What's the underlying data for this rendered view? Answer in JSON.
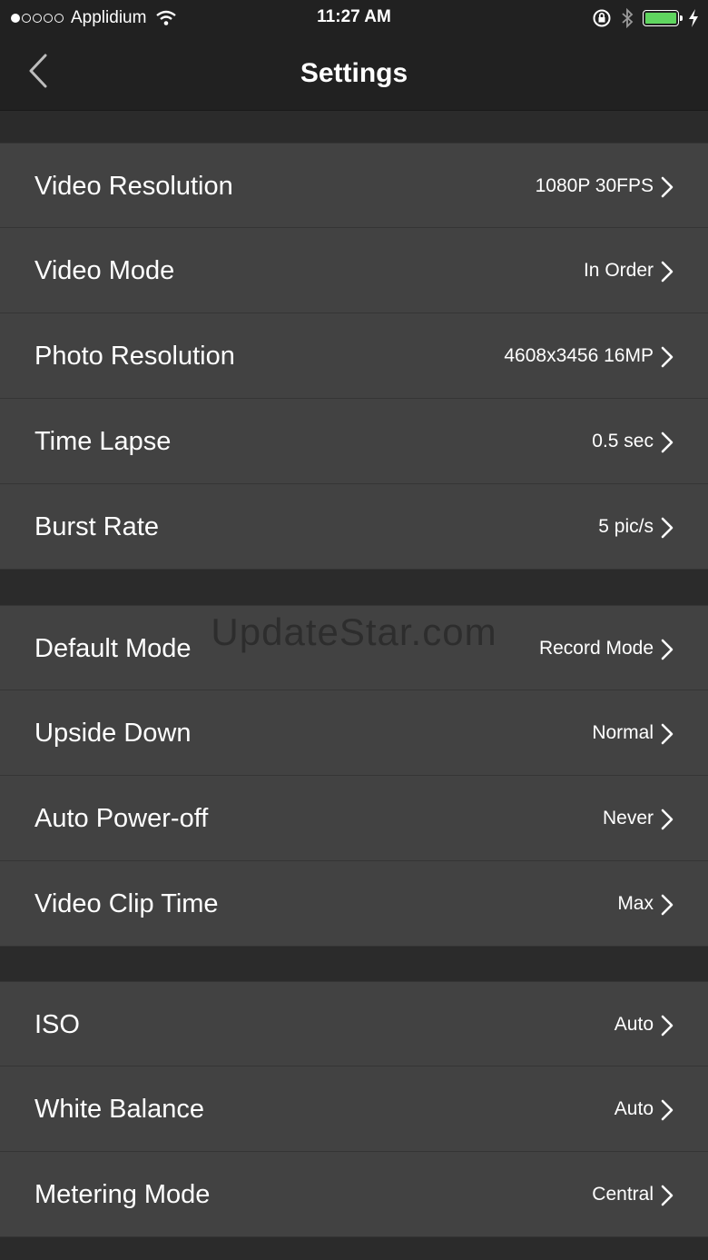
{
  "status_bar": {
    "carrier": "Applidium",
    "time": "11:27 AM",
    "signal_bars_filled": 1,
    "signal_bars_total": 5,
    "battery_color": "#5fd55f"
  },
  "nav": {
    "title": "Settings",
    "back_icon": "chevron-left-icon"
  },
  "sections": [
    {
      "rows": [
        {
          "label": "Video Resolution",
          "value": "1080P 30FPS"
        },
        {
          "label": "Video Mode",
          "value": "In Order"
        },
        {
          "label": "Photo Resolution",
          "value": "4608x3456 16MP"
        },
        {
          "label": "Time Lapse",
          "value": "0.5 sec"
        },
        {
          "label": "Burst Rate",
          "value": "5 pic/s"
        }
      ]
    },
    {
      "rows": [
        {
          "label": "Default Mode",
          "value": "Record Mode"
        },
        {
          "label": "Upside Down",
          "value": "Normal"
        },
        {
          "label": "Auto Power-off",
          "value": "Never"
        },
        {
          "label": "Video Clip Time",
          "value": "Max"
        }
      ]
    },
    {
      "rows": [
        {
          "label": "ISO",
          "value": "Auto"
        },
        {
          "label": "White Balance",
          "value": "Auto"
        },
        {
          "label": "Metering Mode",
          "value": "Central"
        }
      ]
    }
  ],
  "watermark": "UpdateStar.com",
  "colors": {
    "background": "#2b2b2b",
    "bar": "#212121",
    "row": "#424242",
    "chevron": "#ffffff"
  }
}
